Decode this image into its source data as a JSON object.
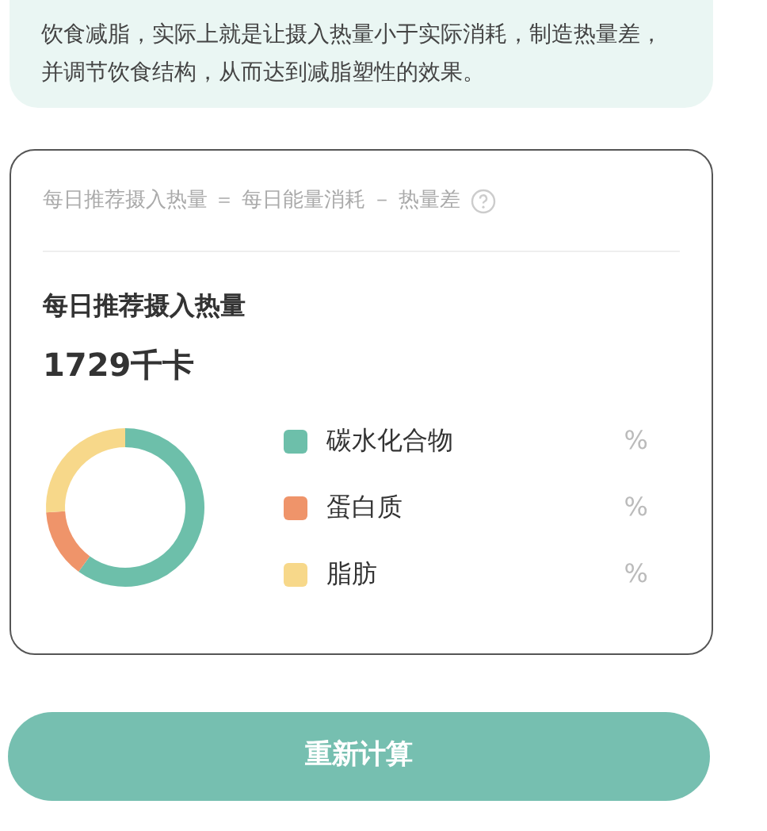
{
  "intro": {
    "text": "饮食减脂，实际上就是让摄入热量小于实际消耗，制造热量差，并调节饮食结构，从而达到减脂塑性的效果。"
  },
  "card": {
    "formula": "每日推荐摄入热量 ＝ 每日能量消耗 － 热量差",
    "title": "每日推荐摄入热量",
    "value": "1729千卡",
    "legend": [
      {
        "label": "碳水化合物",
        "unit": "%",
        "color": "#6dbfaa"
      },
      {
        "label": "蛋白质",
        "unit": "%",
        "color": "#ef946a"
      },
      {
        "label": "脂肪",
        "unit": "%",
        "color": "#f7d88a"
      }
    ]
  },
  "button": {
    "label": "重新计算"
  }
}
